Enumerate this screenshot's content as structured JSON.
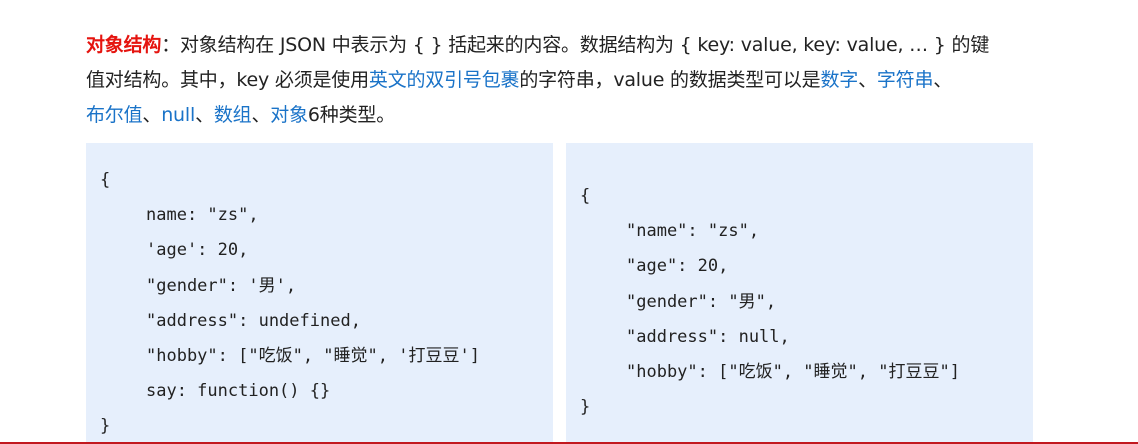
{
  "intro": {
    "line1": {
      "term": "对象结构",
      "text": "：对象结构在 JSON 中表示为 { } 括起来的内容。数据结构为 { key: value, key: value, … } 的键"
    },
    "line2": {
      "text_a": "值对结构。其中，key 必须是使用",
      "highlight_a": "英文的双引号包裹",
      "text_b": "的字符串，value 的数据类型可以是",
      "highlight_b": "数字",
      "sep_b": "、",
      "highlight_c": "字符串",
      "sep_c": "、"
    },
    "line3": {
      "highlight_a": "布尔值",
      "sep_a": "、",
      "highlight_b": "null",
      "sep_b": "、",
      "highlight_c": "数组",
      "sep_c": "、",
      "highlight_d": "对象",
      "text_end": "6种类型。"
    }
  },
  "code_left": {
    "lines": [
      "{",
      "name: \"zs\",",
      "'age': 20,",
      "\"gender\": '男',",
      "\"address\": undefined,",
      "\"hobby\": [\"吃饭\", \"睡觉\", '打豆豆']",
      "say: function() {}",
      "}"
    ]
  },
  "code_right": {
    "lines": [
      "{",
      "\"name\": \"zs\",",
      "\"age\": 20,",
      "\"gender\": \"男\",",
      "\"address\": null,",
      "\"hobby\": [\"吃饭\", \"睡觉\", \"打豆豆\"]",
      "}"
    ]
  },
  "colors": {
    "term": "#e5140f",
    "highlight": "#1a73c8",
    "code_background": "#e6effc",
    "bottom_rule": "#c2181f"
  }
}
